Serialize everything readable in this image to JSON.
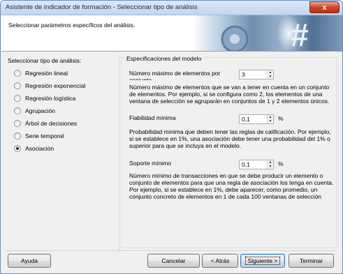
{
  "window": {
    "title": "Asistente de indicador de formación - Seleccionar tipo de análisis",
    "close_label": "x"
  },
  "header": {
    "text": "Seleccionar parámetros específicos del análisis."
  },
  "left_panel": {
    "title": "Seleccionar tipo de análisis:",
    "options": [
      {
        "label": "Regresión lineal",
        "checked": false
      },
      {
        "label": "Regresión exponencial",
        "checked": false
      },
      {
        "label": "Regresión logística",
        "checked": false
      },
      {
        "label": "Agrupación",
        "checked": false
      },
      {
        "label": "Árbol de decisiones",
        "checked": false
      },
      {
        "label": "Serie temporal",
        "checked": false
      },
      {
        "label": "Asociación",
        "checked": true
      }
    ]
  },
  "model": {
    "group_title": "Especificaciones del modelo",
    "max_elements": {
      "label": "Número máximo de elementos por",
      "label_cont": "conjunto",
      "value": "3",
      "description": "Número máximo de elementos que se van a tener en cuenta en un conjunto de elementos. Por ejemplo, si se configura como 2, los elementos de una ventana de selección se agruparán en conjuntos de 1 y 2 elementos únicos."
    },
    "min_reliability": {
      "label": "Fiabilidad mínima",
      "value": "0,1",
      "unit": "%",
      "description": "Probabilidad mínima que deben tener las reglas de calificación. Por ejemplo, si se establece en 1%, una asociación debe tener una probabilidad del 1% o superior para que se incluya en el modelo."
    },
    "min_support": {
      "label": "Soporte mínimo",
      "value": "0,1",
      "unit": "%",
      "description": "Número mínimo de transacciones en que se debe producir un elemento o conjunto de elementos para que una regla de asociación los tenga en cuenta. Por ejemplo, si se establece en 1%, debe aparecer, como promedio, un conjunto concreto de elementos en 1 de cada 100 ventanas de selección"
    }
  },
  "buttons": {
    "help": "Ayuda",
    "cancel": "Cancelar",
    "back": "< Atrás",
    "next": "Siguiente >",
    "finish": "Terminar"
  }
}
